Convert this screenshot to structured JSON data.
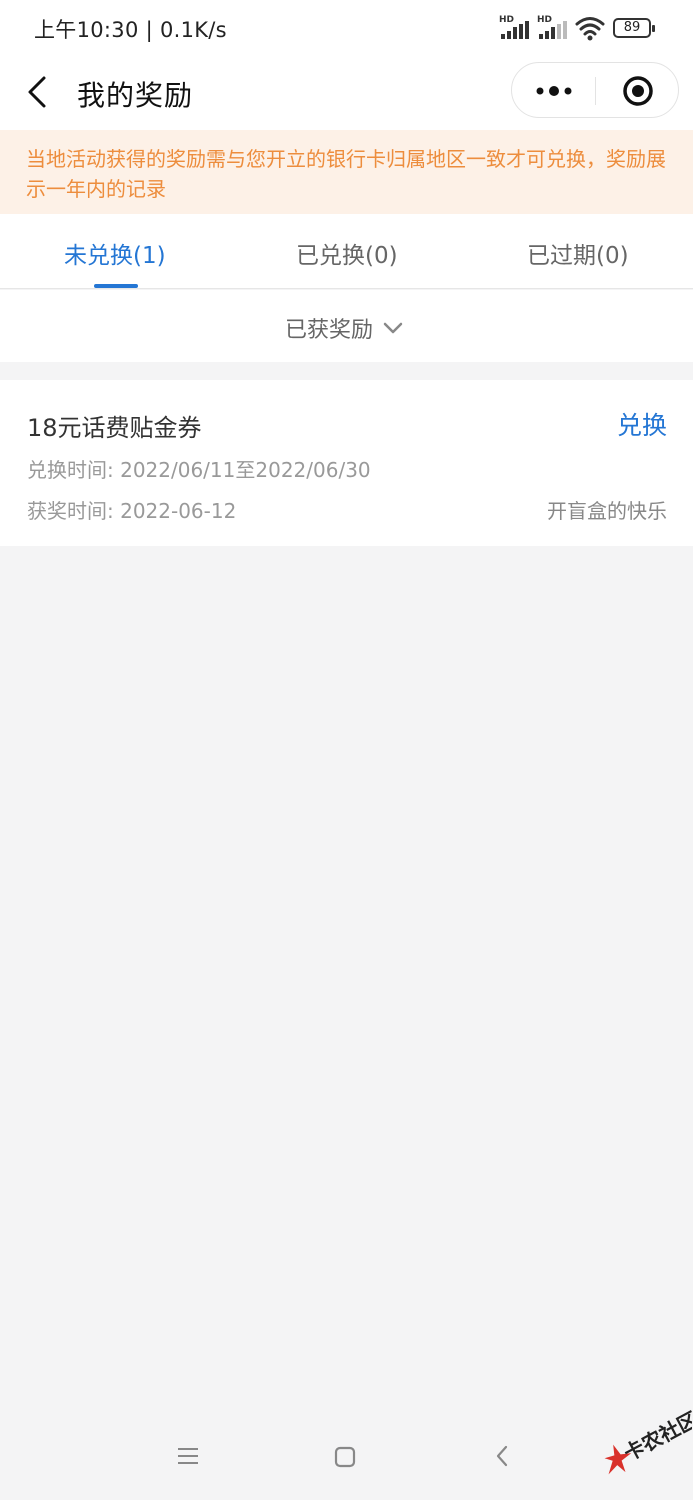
{
  "status_bar": {
    "time_speed": "上午10:30 | 0.1K/s",
    "signal_label_1": "HD",
    "signal_label_2": "HD",
    "battery": "89"
  },
  "nav": {
    "title": "我的奖励"
  },
  "notice": {
    "text": "当地活动获得的奖励需与您开立的银行卡归属地区一致才可兑换，奖励展示一年内的记录"
  },
  "tabs": [
    {
      "label": "未兑换(1)",
      "active": true
    },
    {
      "label": "已兑换(0)",
      "active": false
    },
    {
      "label": "已过期(0)",
      "active": false
    }
  ],
  "filter": {
    "label": "已获奖励"
  },
  "rewards": [
    {
      "title": "18元话费贴金券",
      "action": "兑换",
      "redeem_time": "兑换时间: 2022/06/11至2022/06/30",
      "award_time": "获奖时间: 2022-06-12",
      "source": "开盲盒的快乐"
    }
  ],
  "watermark": {
    "text": "卡农社区"
  },
  "colors": {
    "accent": "#2476d4",
    "notice_bg": "#fdf1e7",
    "notice_text": "#ed8d3d",
    "page_bg": "#f4f4f5"
  }
}
